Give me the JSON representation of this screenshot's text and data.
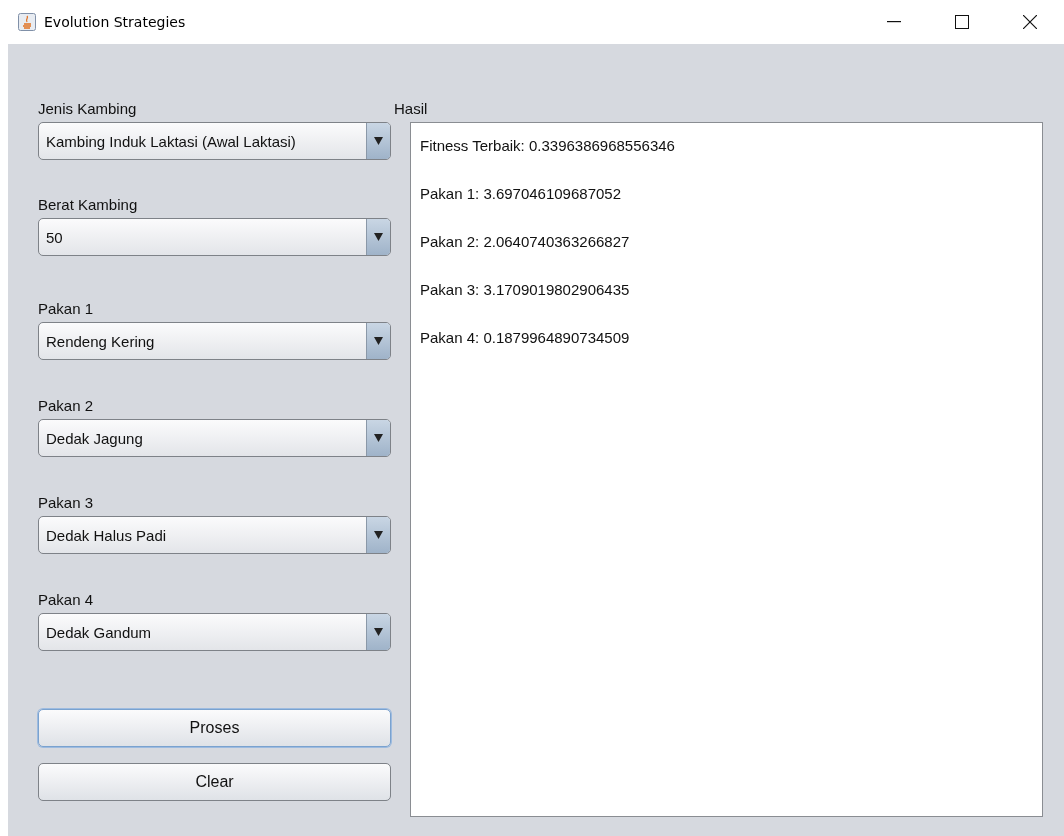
{
  "window": {
    "title": "Evolution Strategies"
  },
  "fields": [
    {
      "label": "Jenis Kambing",
      "value": "Kambing Induk Laktasi (Awal Laktasi)"
    },
    {
      "label": "Berat Kambing",
      "value": "50"
    },
    {
      "label": "Pakan 1",
      "value": "Rendeng Kering"
    },
    {
      "label": "Pakan 2",
      "value": "Dedak Jagung"
    },
    {
      "label": "Pakan 3",
      "value": "Dedak Halus Padi"
    },
    {
      "label": "Pakan 4",
      "value": "Dedak Gandum"
    }
  ],
  "buttons": [
    {
      "label": "Proses",
      "focused": true
    },
    {
      "label": "Clear",
      "focused": false
    }
  ],
  "result": {
    "label": "Hasil",
    "lines": [
      "Fitness Terbaik: 0.3396386968556346",
      "Pakan 1: 3.697046109687052",
      "Pakan 2: 2.0640740363266827",
      "Pakan 3: 3.1709019802906435",
      "Pakan 4: 0.1879964890734509"
    ]
  }
}
